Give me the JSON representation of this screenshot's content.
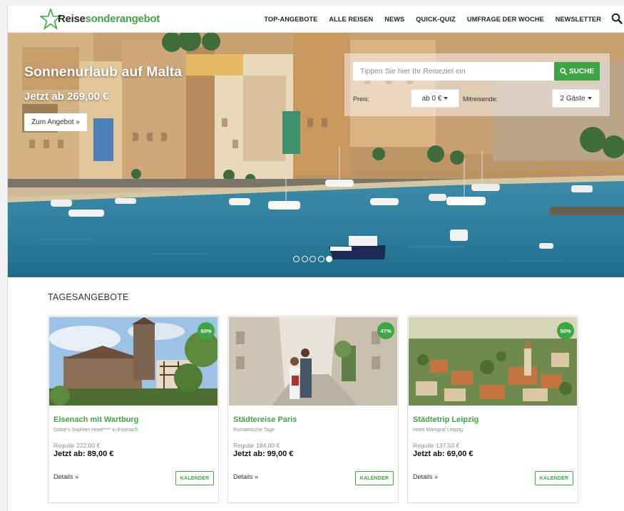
{
  "brand": {
    "logo_part1": "Reise",
    "logo_part2": "sonderangebot",
    "green": "#3fa644"
  },
  "nav": {
    "items": [
      "TOP-ANGEBOTE",
      "ALLE REISEN",
      "NEWS",
      "QUICK-QUIZ",
      "UMFRAGE DER WOCHE",
      "NEWSLETTER"
    ],
    "search_icon": "search-icon"
  },
  "hero": {
    "title": "Sonnenurlaub auf Malta",
    "price": "Jetzt ab 269,00 €",
    "button": "Zum Angebot »",
    "slides_total": 5,
    "active_slide": 5
  },
  "search": {
    "placeholder": "Tippen Sie hier Ihr Reiseziel ein",
    "submit": "SUCHE",
    "price_label": "Preis:",
    "price_value": "ab 0 €",
    "travelers_label": "Mitreisende:",
    "travelers_value": "2 Gäste"
  },
  "daily_offers": {
    "title": "TAGESANGEBOTE",
    "cards": [
      {
        "badge": "60%",
        "title": "Eisenach mit Wartburg",
        "subtitle": "Göbel's Sophien Hotel**** in Eisenach",
        "regular": "Regulär 222,00 €",
        "price": "Jetzt ab: 89,00 €",
        "details": "Details »",
        "calendar": "KALENDER"
      },
      {
        "badge": "47%",
        "title": "Städtereise Paris",
        "subtitle": "Romantische Tage",
        "regular": "Regulär 184,00 €",
        "price": "Jetzt ab: 99,00 €",
        "details": "Details »",
        "calendar": "KALENDER"
      },
      {
        "badge": "50%",
        "title": "Städtetrip Leipzig",
        "subtitle": "Hotel Markgraf Leipzig",
        "regular": "Regulär 137,50 €",
        "price": "Jetzt ab: 69,00 €",
        "details": "Details »",
        "calendar": "KALENDER"
      }
    ]
  }
}
